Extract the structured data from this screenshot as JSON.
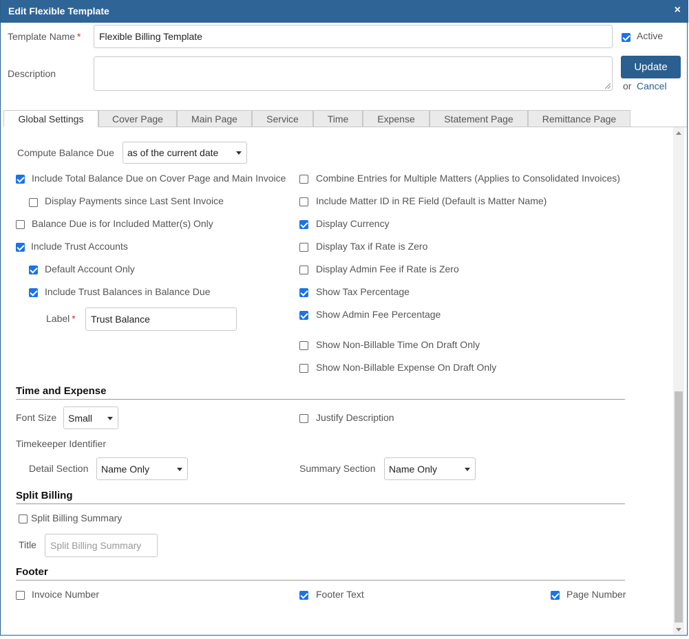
{
  "dialog": {
    "title": "Edit Flexible Template",
    "close_icon": "close-icon",
    "close_glyph": "×"
  },
  "header": {
    "template_name_label": "Template Name",
    "template_name_value": "Flexible Billing Template",
    "required_mark": "*",
    "active_label": "Active",
    "active_checked": true,
    "description_label": "Description",
    "description_value": "",
    "update_label": "Update",
    "or_label": "or",
    "cancel_label": "Cancel"
  },
  "tabs": [
    {
      "label": "Global Settings",
      "active": true
    },
    {
      "label": "Cover Page",
      "active": false
    },
    {
      "label": "Main Page",
      "active": false
    },
    {
      "label": "Service",
      "active": false
    },
    {
      "label": "Time",
      "active": false
    },
    {
      "label": "Expense",
      "active": false
    },
    {
      "label": "Statement Page",
      "active": false
    },
    {
      "label": "Remittance Page",
      "active": false
    }
  ],
  "global": {
    "compute_balance_label": "Compute Balance Due",
    "compute_balance_value": "as of the current date",
    "left_options": [
      {
        "label": "Include Total Balance Due on Cover Page and Main Invoice",
        "checked": true
      },
      {
        "label": "Display Payments since Last Sent Invoice",
        "checked": false
      },
      {
        "label": "Balance Due is for Included Matter(s) Only",
        "checked": false
      },
      {
        "label": "Include Trust Accounts",
        "checked": true
      },
      {
        "label": "Default Account Only",
        "checked": true
      },
      {
        "label": "Include Trust Balances in Balance Due",
        "checked": true
      }
    ],
    "trust_label_label": "Label",
    "trust_label_value": "Trust Balance",
    "right_options": [
      {
        "label": "Combine Entries for Multiple Matters (Applies to Consolidated Invoices)",
        "checked": false
      },
      {
        "label": "Include Matter ID in RE Field (Default is Matter Name)",
        "checked": false
      },
      {
        "label": "Display Currency",
        "checked": true
      },
      {
        "label": "Display Tax if Rate is Zero",
        "checked": false
      },
      {
        "label": "Display Admin Fee if Rate is Zero",
        "checked": false
      },
      {
        "label": "Show Tax Percentage",
        "checked": true
      },
      {
        "label": "Show Admin Fee Percentage",
        "checked": true
      },
      {
        "label": "Show Non-Billable Time On Draft Only",
        "checked": false
      },
      {
        "label": "Show Non-Billable Expense On Draft Only",
        "checked": false
      }
    ]
  },
  "time_expense": {
    "heading": "Time and Expense",
    "font_size_label": "Font Size",
    "font_size_value": "Small",
    "justify_label": "Justify Description",
    "justify_checked": false,
    "timekeeper_label": "Timekeeper Identifier",
    "detail_label": "Detail Section",
    "detail_value": "Name Only",
    "summary_label": "Summary Section",
    "summary_value": "Name Only"
  },
  "split_billing": {
    "heading": "Split Billing",
    "summary_label": "Split Billing Summary",
    "summary_checked": false,
    "title_label": "Title",
    "title_placeholder": "Split Billing Summary"
  },
  "footer": {
    "heading": "Footer",
    "invoice_number_label": "Invoice Number",
    "invoice_number_checked": false,
    "footer_text_label": "Footer Text",
    "footer_text_checked": true,
    "page_number_label": "Page Number",
    "page_number_checked": true
  }
}
